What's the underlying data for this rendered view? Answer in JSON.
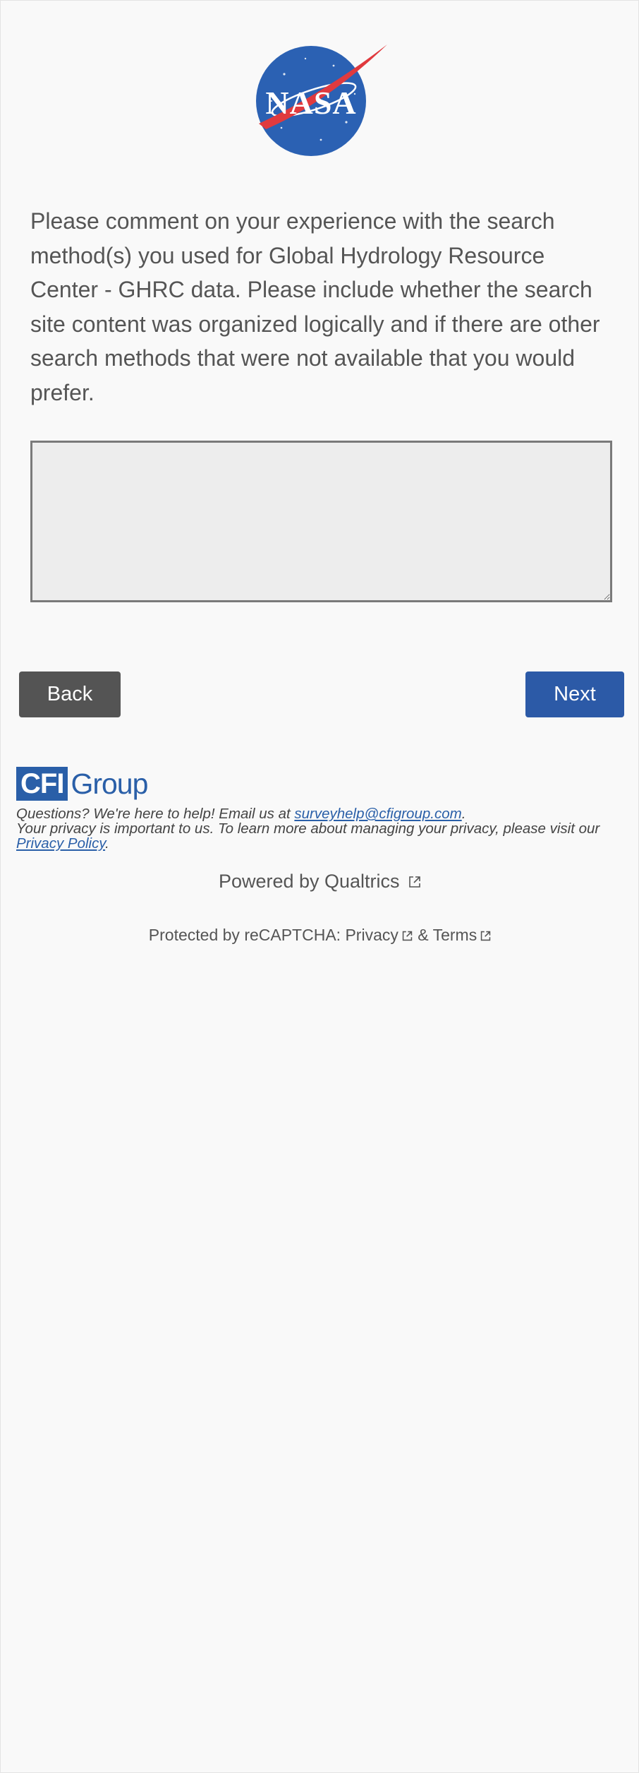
{
  "logo": {
    "label": "NASA",
    "colors": {
      "globe": "#2b61b3",
      "swoosh": "#e03a3e",
      "text": "#ffffff"
    }
  },
  "question": {
    "text": "Please comment on your experience with the search method(s) you used for Global Hydrology Resource Center - GHRC data. Please include whether the search site content was organized logically and if there are other search methods that were not available that you would prefer."
  },
  "answer": {
    "value": "",
    "placeholder": ""
  },
  "navigation": {
    "back_label": "Back",
    "next_label": "Next",
    "colors": {
      "back": "#545454",
      "next": "#2c5aa7"
    }
  },
  "footer": {
    "brand_box": "CFI",
    "brand_word": "Group",
    "help_prefix": "Questions? We're here to help! Email us at ",
    "help_email": "surveyhelp@cfigroup.com",
    "help_suffix": ".",
    "privacy_prefix": "Your privacy is important to us. To learn more about managing your privacy, please visit our ",
    "privacy_link": "Privacy Policy",
    "privacy_suffix": "."
  },
  "powered_by": {
    "label": "Powered by Qualtrics",
    "icon": "external-link-icon"
  },
  "recaptcha": {
    "prefix": "Protected by reCAPTCHA: ",
    "privacy_label": "Privacy",
    "separator": " & ",
    "terms_label": "Terms"
  }
}
